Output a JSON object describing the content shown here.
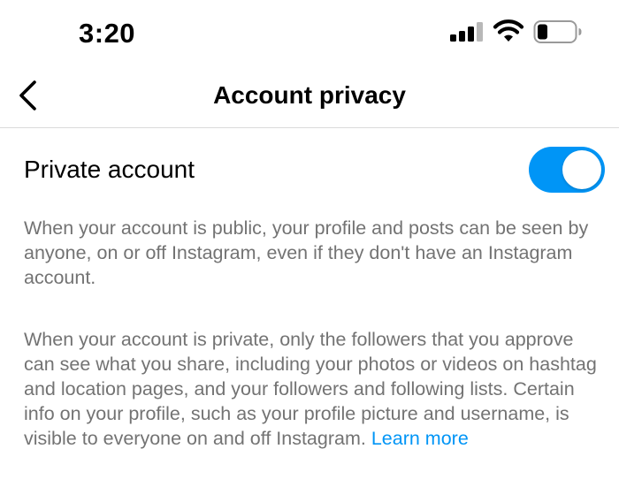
{
  "status_bar": {
    "time": "3:20"
  },
  "header": {
    "title": "Account privacy",
    "back_icon": "chevron-left-icon"
  },
  "private_account": {
    "label": "Private account",
    "enabled": true,
    "toggle_color": "#0095f6"
  },
  "descriptions": {
    "public_text": "When your account is public, your profile and posts can be seen by anyone, on or off Instagram, even if they don't have an Instagram account.",
    "private_text": "When your account is private, only the followers that you approve can see what you share, including your photos or videos on hashtag and location pages, and your followers and following lists. Certain info on your profile, such as your profile picture and username, is visible to everyone on and off Instagram.",
    "learn_more": "Learn more"
  },
  "colors": {
    "link": "#0095f6",
    "secondary_text": "#737373",
    "divider": "#dbdbdb"
  }
}
